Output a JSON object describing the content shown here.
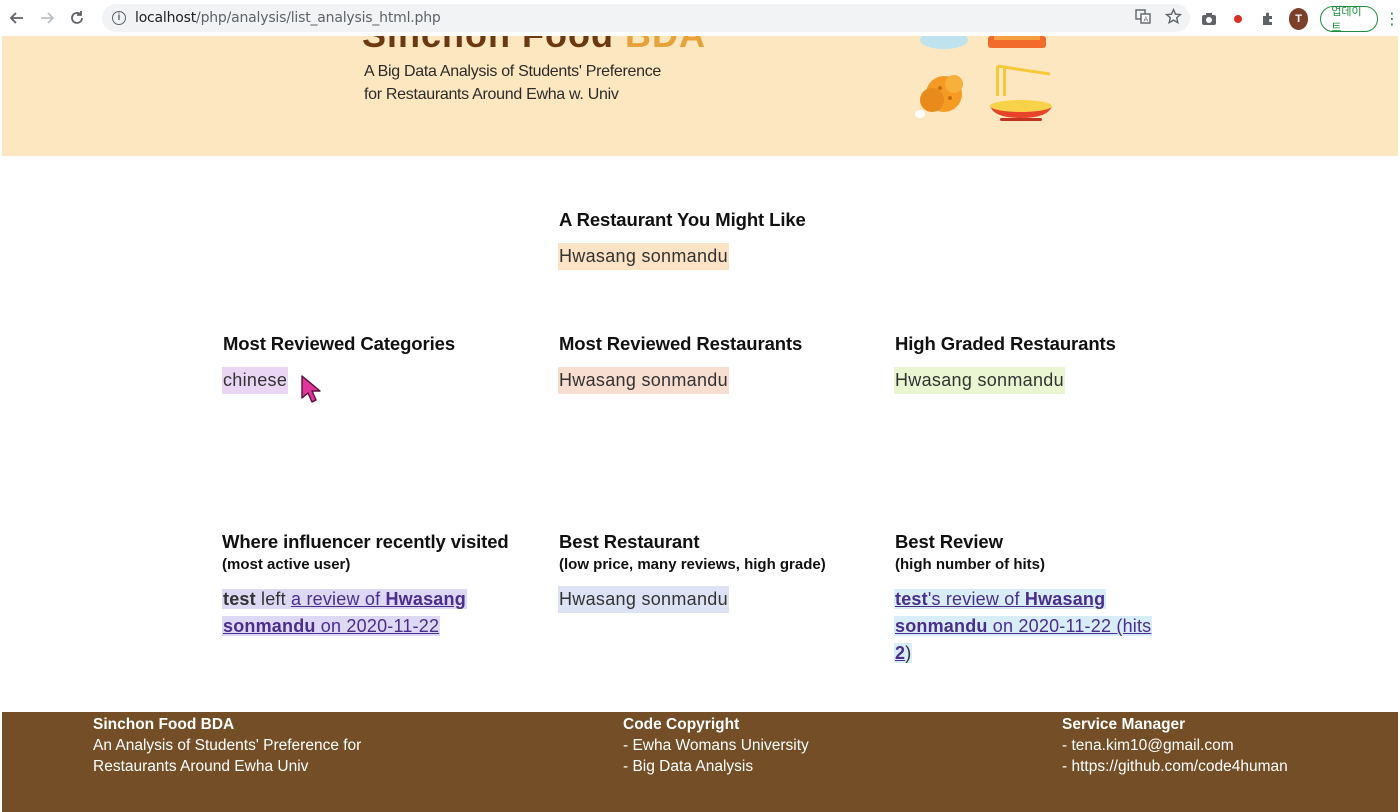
{
  "browser": {
    "url_host": "localhost",
    "url_path": "/php/analysis/list_analysis_html.php",
    "avatar_letter": "T",
    "update_label": "업데이트"
  },
  "header": {
    "logo_text_main": "Sinchon Food ",
    "logo_text_accent": "BDA",
    "tagline_line1": "A Big Data Analysis of Students' Preference",
    "tagline_line2": "for Restaurants Around Ewha w. Univ"
  },
  "recommend": {
    "title": "A Restaurant You Might Like",
    "value": "Hwasang sonmandu"
  },
  "row1": {
    "categories": {
      "title": "Most Reviewed Categories",
      "value": "chinese"
    },
    "reviewed_restaurants": {
      "title": "Most Reviewed Restaurants",
      "value": "Hwasang sonmandu"
    },
    "graded_restaurants": {
      "title": "High Graded Restaurants",
      "value": "Hwasang sonmandu"
    }
  },
  "row2": {
    "influencer": {
      "title": "Where influencer recently visited",
      "subtitle": "(most active user)",
      "user": "test",
      "left_text": " left ",
      "link_prefix": "a review of ",
      "restaurant_part1": "Hwasang",
      "restaurant_part2": "sonmandu",
      "date_text": " on 2020-11-22"
    },
    "best_restaurant": {
      "title": "Best Restaurant",
      "subtitle": "(low price, many reviews, high grade)",
      "value": "Hwasang sonmandu"
    },
    "best_review": {
      "title": "Best Review",
      "subtitle": "(high number of hits)",
      "user": "test",
      "review_of": "'s review of ",
      "restaurant_part1": "Hwasang",
      "restaurant_part2": "sonmandu",
      "date_hits": " on 2020-11-22 (hits",
      "hits_count": "2",
      "close_paren": ")"
    }
  },
  "footer": {
    "col1_title": "Sinchon Food BDA",
    "col1_line1": "An Analysis of Students' Preference for",
    "col1_line2": "Restaurants Around Ewha Univ",
    "col2_title": "Code Copyright",
    "col2_line1": "- Ewha Womans University",
    "col2_line2": "- Big Data Analysis",
    "col3_title": "Service Manager",
    "col3_line1": "- tena.kim10@gmail.com",
    "col3_line2": "- https://github.com/code4human"
  },
  "icons": [
    "back-arrow-icon",
    "forward-arrow-icon",
    "reload-icon",
    "info-icon",
    "translate-icon",
    "star-icon",
    "camera-icon",
    "record-icon",
    "puzzle-icon",
    "kebab-menu-icon",
    "mouse-cursor-icon"
  ],
  "colors": {
    "banner_bg": "#fde7c0",
    "footer_bg": "#734e27",
    "link": "#4a2d8c"
  }
}
